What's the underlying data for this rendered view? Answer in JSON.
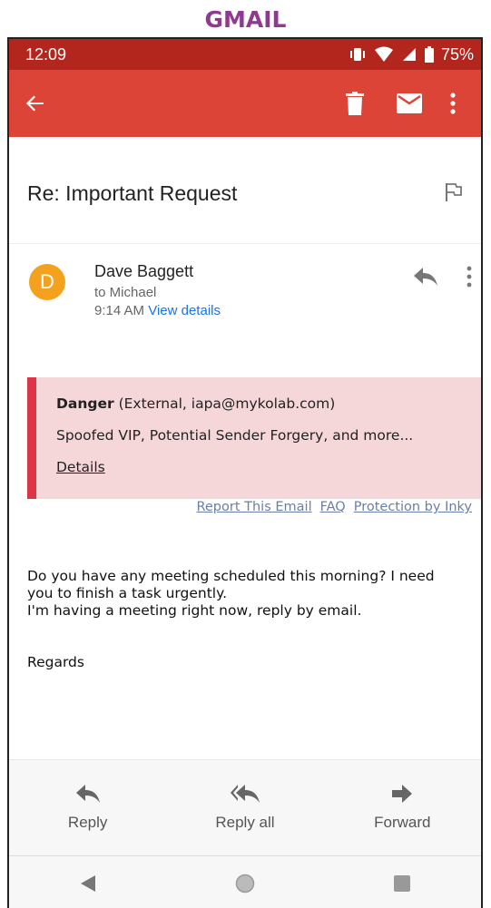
{
  "banner": {
    "title": "GMAIL"
  },
  "status_bar": {
    "time": "12:09",
    "battery": "75%"
  },
  "app_bar": {
    "back_icon": "arrow-left-icon",
    "delete_icon": "trash-icon",
    "mark_unread_icon": "envelope-icon",
    "more_icon": "more-vert-icon"
  },
  "email": {
    "subject": "Re: Important Request",
    "sender": {
      "initial": "D",
      "name": "Dave Baggett",
      "to": "to Michael",
      "time": "9:14 AM",
      "view_details": "View details"
    },
    "alert": {
      "level": "Danger",
      "source": "(External, iapa@mykolab.com)",
      "reasons": "Spoofed VIP, Potential Sender Forgery, and more...",
      "details_link": "Details"
    },
    "inky_links": [
      "Report This Email",
      "FAQ",
      "Protection by Inky"
    ],
    "body": {
      "line1": "Do you have any meeting scheduled this morning? I need",
      "line2": "you to finish a task urgently.",
      "line3": "I'm having a meeting right now, reply by email.",
      "signoff": "Regards"
    }
  },
  "reply_bar": {
    "reply": "Reply",
    "reply_all": "Reply all",
    "forward": "Forward"
  },
  "colors": {
    "status_bar": "#b3261e",
    "app_bar": "#db4437",
    "avatar": "#f4a11e",
    "alert_bg": "#f6d7d9",
    "alert_border": "#dc3545",
    "link": "#1a73e8",
    "banner": "#8e3a8e"
  }
}
